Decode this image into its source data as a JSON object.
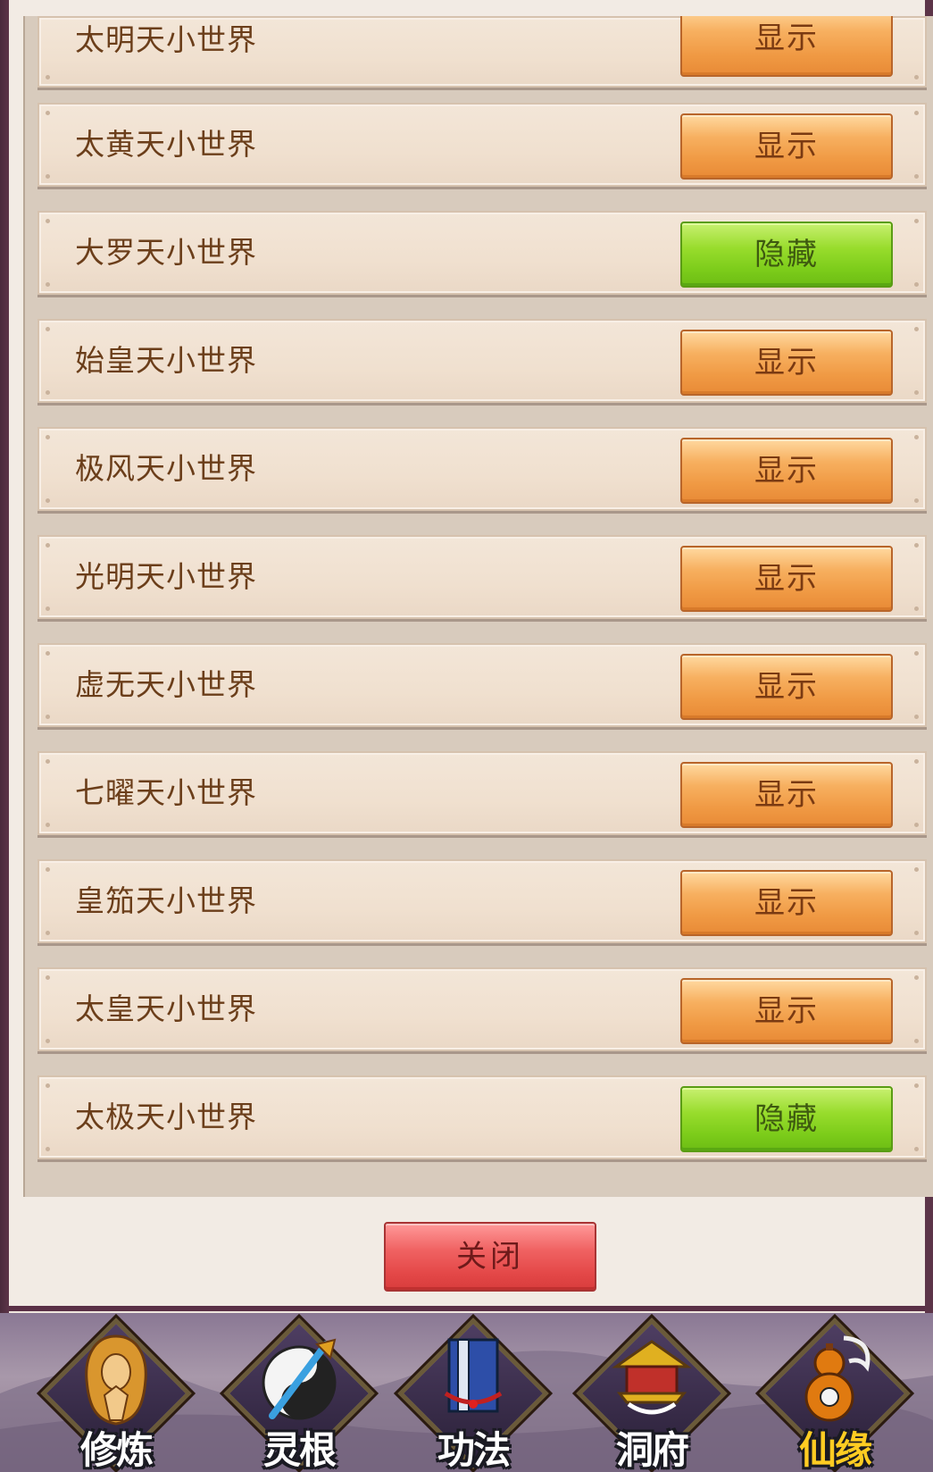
{
  "worlds": [
    {
      "name": "太明天小世界",
      "button": "显示",
      "state": "show"
    },
    {
      "name": "太黄天小世界",
      "button": "显示",
      "state": "show"
    },
    {
      "name": "大罗天小世界",
      "button": "隐藏",
      "state": "hide"
    },
    {
      "name": "始皇天小世界",
      "button": "显示",
      "state": "show"
    },
    {
      "name": "极风天小世界",
      "button": "显示",
      "state": "show"
    },
    {
      "name": "光明天小世界",
      "button": "显示",
      "state": "show"
    },
    {
      "name": "虚无天小世界",
      "button": "显示",
      "state": "show"
    },
    {
      "name": "七曜天小世界",
      "button": "显示",
      "state": "show"
    },
    {
      "name": "皇笳天小世界",
      "button": "显示",
      "state": "show"
    },
    {
      "name": "太皇天小世界",
      "button": "显示",
      "state": "show"
    },
    {
      "name": "太极天小世界",
      "button": "隐藏",
      "state": "hide"
    }
  ],
  "dialog": {
    "close_label": "关闭"
  },
  "nav": [
    {
      "label": "修炼",
      "icon": "cultivation-icon"
    },
    {
      "label": "灵根",
      "icon": "spirit-root-icon"
    },
    {
      "label": "功法",
      "icon": "technique-book-icon"
    },
    {
      "label": "洞府",
      "icon": "cave-dwelling-icon"
    },
    {
      "label": "仙缘",
      "icon": "gourd-icon",
      "active": true
    }
  ],
  "colors": {
    "show_button": "#f09a44",
    "hide_button": "#7ccc1a",
    "close_button": "#e44848",
    "active_nav": "#ffcc22"
  }
}
